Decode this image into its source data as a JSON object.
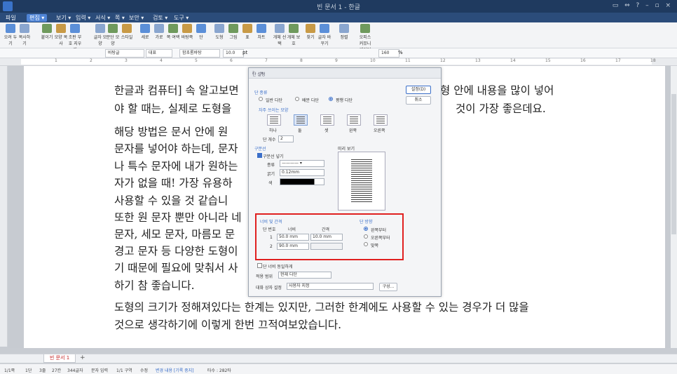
{
  "window": {
    "title": "빈 문서 1 - 한글",
    "controls": "▭ ⇔ ?   –  ▫  ×"
  },
  "menu": [
    {
      "label": "파일",
      "active": false
    },
    {
      "label": "편집 ▾",
      "active": true
    },
    {
      "label": "보기 ▾",
      "active": false
    },
    {
      "label": "입력 ▾",
      "active": false
    },
    {
      "label": "서식 ▾",
      "active": false
    },
    {
      "label": "쪽 ▾",
      "active": false
    },
    {
      "label": "보안 ▾",
      "active": false
    },
    {
      "label": "검토 ▾",
      "active": false
    },
    {
      "label": "도구 ▾",
      "active": false
    }
  ],
  "ribbon": [
    {
      "label": "오려 두기",
      "icon": "scissors-icon"
    },
    {
      "label": "복사하기",
      "icon": "copy-icon"
    },
    {
      "label": "붙이기",
      "icon": "paste-icon"
    },
    {
      "label": "모양 복사",
      "icon": "format-copy-icon"
    },
    {
      "label": "조판 부호 지우기",
      "icon": "clear-icon"
    },
    {
      "label": "글자 모양",
      "icon": "char-shape-icon"
    },
    {
      "label": "문단 모양",
      "icon": "para-shape-icon"
    },
    {
      "label": "스타일",
      "icon": "style-icon"
    },
    {
      "label": "세로",
      "icon": "vertical-icon"
    },
    {
      "label": "가로",
      "icon": "horizontal-icon"
    },
    {
      "label": "쪽 여백",
      "icon": "margin-icon"
    },
    {
      "label": "바탕쪽",
      "icon": "master-page-icon"
    },
    {
      "label": "단",
      "icon": "columns-icon"
    },
    {
      "label": "도형",
      "icon": "shape-icon"
    },
    {
      "label": "그림",
      "icon": "image-icon"
    },
    {
      "label": "표",
      "icon": "table-icon"
    },
    {
      "label": "차트",
      "icon": "chart-icon"
    },
    {
      "label": "개체 선택",
      "icon": "select-object-icon"
    },
    {
      "label": "개체 보호",
      "icon": "protect-icon"
    },
    {
      "label": "찾기",
      "icon": "find-icon"
    },
    {
      "label": "글자 바꾸기",
      "icon": "replace-icon"
    },
    {
      "label": "정렬",
      "icon": "sort-icon"
    },
    {
      "label": "오피스 커뮤니케이터",
      "icon": "communicator-icon"
    }
  ],
  "toolbar2": {
    "style": "바탕글",
    "lang": "대표",
    "font": "함초롬바탕",
    "size": "10.0",
    "unit": "pt",
    "zoom": "160",
    "zoom_unit": "%"
  },
  "ruler_marks": [
    "1",
    "2",
    "3",
    "4",
    "5",
    "6",
    "7",
    "8",
    "9",
    "10",
    "11",
    "12",
    "13",
    "14",
    "15",
    "16",
    "17",
    "18"
  ],
  "document": {
    "lines": [
      "한글과 컴퓨터] 속 알고보면",
      "야 할 때는, 실제로 도형을",
      "해당 방법은 문서 안에 원",
      "문자를 넣어야 하는데, 문자",
      "나 특수 문자에 내가 원하는",
      "자가 없을 때! 가장 유용하",
      "사용할 수 있을 것 같습니",
      "또한 원 문자 뿐만 아니라 네",
      "문자, 세모 문자, 마름모 문",
      "경고 문자 등 다양한 도형이",
      "기 때문에 필요에 맞춰서 사",
      "하기 참 좋습니다."
    ],
    "right_lines": [
      "]형 안에 내용을 많이 넣어",
      "것이 가장 좋은데요."
    ],
    "full_lines": [
      "도형의 크기가 정해져있다는 한계는 있지만, 그러한 한계에도 사용할 수 있는 경우가 더 많을",
      "것으로 생각하기에 이렇게 한번 끄적여보았습니다."
    ]
  },
  "dialog": {
    "title": "단 설정",
    "title_controls": "? ×",
    "set_button": "설정(D)",
    "cancel_button": "취소",
    "type_section": "단 종류",
    "type_options": [
      "일반 다단",
      "배분 다단",
      "평행 다단"
    ],
    "type_selected": 2,
    "shape_section": "자주 쓰이는 모양",
    "shapes": [
      "하나",
      "둘",
      "셋",
      "왼쪽",
      "오른쪽"
    ],
    "shape_selected": 1,
    "count_label": "단 개수",
    "count_value": "2",
    "divider_section": "구분선",
    "divider_check": "구분선 넣기",
    "divider_type_label": "종류",
    "divider_width_label": "굵기",
    "divider_width_value": "0.12mm",
    "divider_color_label": "색",
    "preview_label": "미리 보기",
    "spacing_section": "너비 및 간격",
    "col_no_label": "단 번호",
    "width_label": "너비",
    "gap_label": "간격",
    "rows": [
      {
        "no": "1",
        "width": "50.0",
        "unit": "mm",
        "gap": "10.0",
        "gap_unit": "mm"
      },
      {
        "no": "2",
        "width": "90.0",
        "unit": "mm",
        "gap": "",
        "gap_unit": ""
      }
    ],
    "direction_section": "단 방향",
    "direction_options": [
      "왼쪽부터",
      "오른쪽부터",
      "맞쪽"
    ],
    "direction_selected": 0,
    "equal_width_check": "단 너비 동일하게",
    "apply_label": "적용 범위",
    "apply_value": "현재 다단",
    "dialog_setting_label": "대화 상자 설정",
    "dialog_setting_value": "사용자 지정",
    "more_button": "구성..."
  },
  "tabs": {
    "doc_tab": "빈 문서 1",
    "add": "+"
  },
  "status": {
    "page": "1/1쪽",
    "col": "1단",
    "line": "3줄",
    "char": "27칸",
    "count": "344글자",
    "mode": "문자 입력",
    "section": "1/1 구역",
    "edit": "수정",
    "track": "변경 내용 [기록 중지]",
    "notes": "타수 : 282타"
  },
  "colors": {
    "accent": "#3b6fc9",
    "highlight_box": "#e02020",
    "title_bg": "#1f3a5f"
  }
}
